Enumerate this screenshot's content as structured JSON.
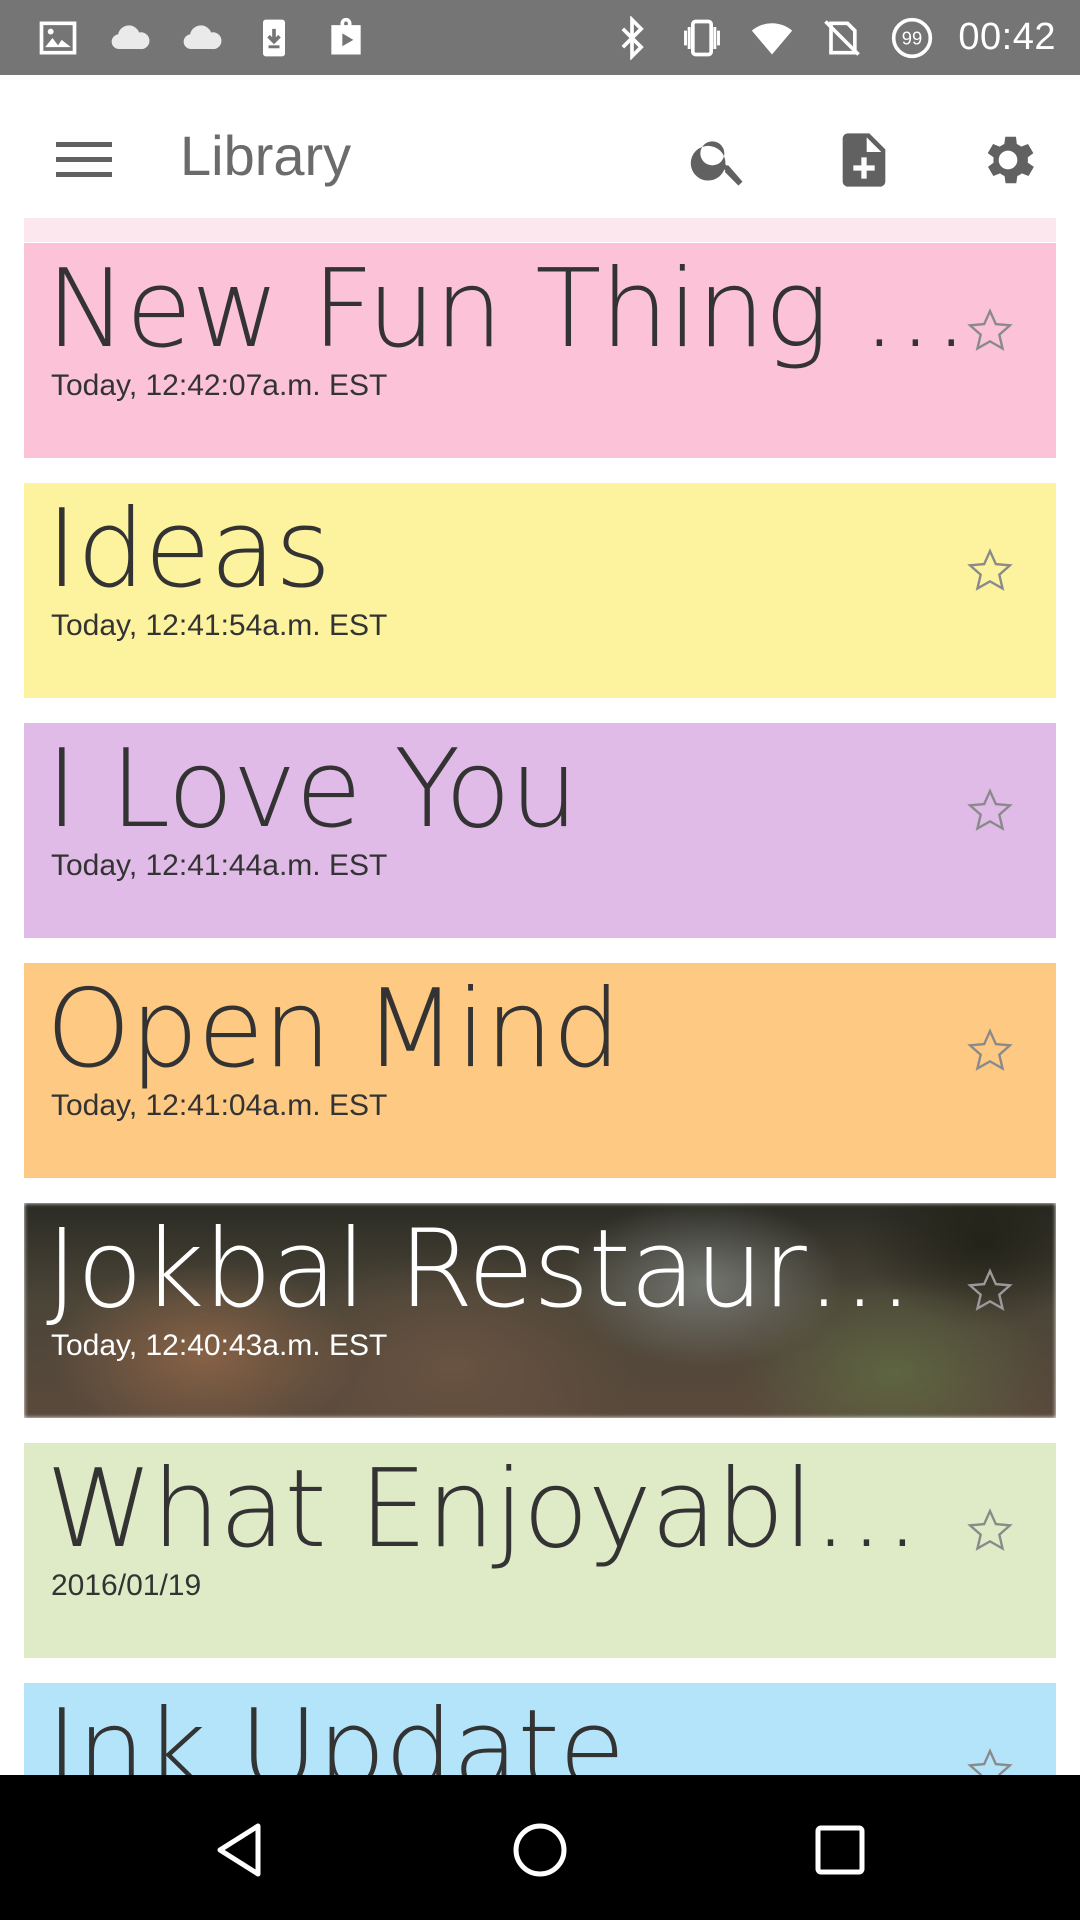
{
  "status_bar": {
    "time": "00:42",
    "left_icons": [
      "image-icon",
      "cloud-icon",
      "cloud-icon",
      "download-icon",
      "play-store-icon"
    ],
    "right_icons": [
      "bluetooth-icon",
      "vibrate-icon",
      "wifi-icon",
      "no-sim-icon",
      "battery-icon"
    ],
    "battery_level": "99"
  },
  "app_bar": {
    "title": "Library",
    "menu_icon": "menu-icon",
    "actions": [
      "search-icon",
      "new-note-icon",
      "settings-icon"
    ]
  },
  "notes": [
    {
      "title": "New Fun Thing T...",
      "date": "Today, 12:42:07a.m. EST",
      "color": "#fcc3d8",
      "starred": false
    },
    {
      "title": "Ideas",
      "date": "Today, 12:41:54a.m. EST",
      "color": "#fdf39e",
      "starred": false
    },
    {
      "title": "I Love You",
      "date": "Today, 12:41:44a.m. EST",
      "color": "#e0bbe7",
      "starred": false
    },
    {
      "title": "Open Mind",
      "date": "Today, 12:41:04a.m. EST",
      "color": "#fdc983",
      "starred": false
    },
    {
      "title": "Jokbal Restaurant",
      "date": "Today, 12:40:43a.m. EST",
      "color": "image",
      "starred": false
    },
    {
      "title": "What Enjoyable...",
      "date": "2016/01/19",
      "color": "#dfebc7",
      "starred": false
    },
    {
      "title": "Ink Update",
      "date": "",
      "color": "#b3e4f9",
      "starred": false
    }
  ],
  "nav_bar": {
    "buttons": [
      "back-icon",
      "home-icon",
      "recents-icon"
    ]
  }
}
